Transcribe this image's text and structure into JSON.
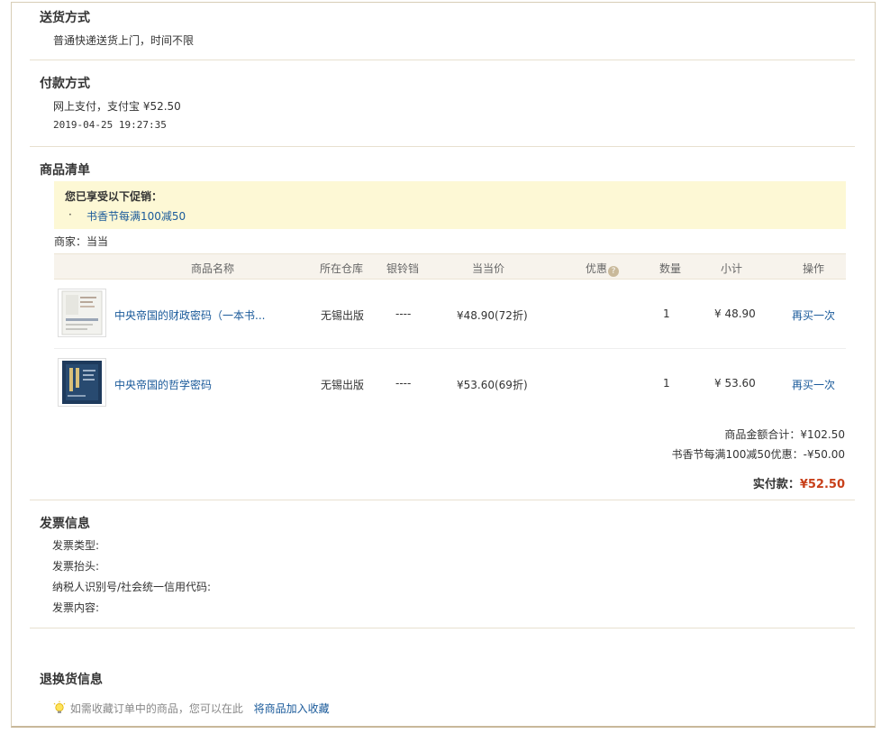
{
  "delivery": {
    "title": "送货方式",
    "detail": "普通快递送货上门，时间不限"
  },
  "payment": {
    "title": "付款方式",
    "method": "网上支付，支付宝 ¥52.50",
    "time": "2019-04-25 19:27:35"
  },
  "goods": {
    "title": "商品清单",
    "promo_title": "您已享受以下促销：",
    "promo_bullet": "·",
    "promo_item": "书香节每满100减50",
    "merchant": "商家：当当",
    "headers": {
      "name": "商品名称",
      "warehouse": "所在仓库",
      "bell": "银铃铛",
      "price": "当当价",
      "discount": "优惠",
      "discount_help": "?",
      "qty": "数量",
      "subtotal": "小计",
      "action": "操作"
    },
    "items": [
      {
        "name": "中央帝国的财政密码（一本书...",
        "warehouse": "无锡出版",
        "bell": "----",
        "price": "¥48.90(72折)",
        "discount": "",
        "qty": "1",
        "subtotal": "¥ 48.90",
        "action": "再买一次"
      },
      {
        "name": "中央帝国的哲学密码",
        "warehouse": "无锡出版",
        "bell": "----",
        "price": "¥53.60(69折)",
        "discount": "",
        "qty": "1",
        "subtotal": "¥ 53.60",
        "action": "再买一次"
      }
    ],
    "summary": {
      "goods_total": "商品金额合计：¥102.50",
      "promo_discount": "书香节每满100减50优惠：-¥50.00",
      "paid_label": "实付款：",
      "paid_value": "¥52.50"
    }
  },
  "invoice": {
    "title": "发票信息",
    "type_label": "发票类型:",
    "header_label": "发票抬头:",
    "tax_id_label": "纳税人识别号/社会统一信用代码:",
    "content_label": "发票内容:"
  },
  "returns": {
    "title": "退换货信息",
    "tip_text": "如需收藏订单中的商品，您可以在此",
    "tip_link": "将商品加入收藏"
  },
  "colors": {
    "accent_price": "#c8401a",
    "link": "#1a5a9a",
    "promo_bg": "#fdf8d5",
    "table_head_bg": "#f7f3ec"
  }
}
